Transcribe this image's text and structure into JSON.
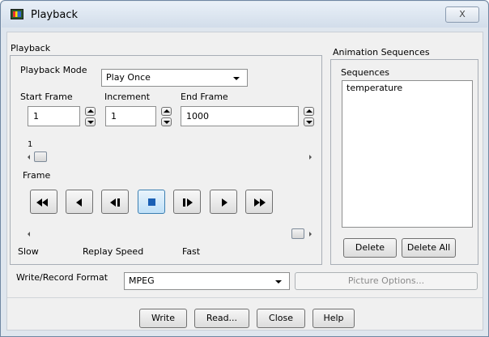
{
  "window": {
    "title": "Playback",
    "close_glyph": "X"
  },
  "playback": {
    "group_label": "Playback",
    "mode_label": "Playback Mode",
    "mode_value": "Play Once",
    "start_frame_label": "Start Frame",
    "increment_label": "Increment",
    "end_frame_label": "End Frame",
    "start_frame_value": "1",
    "increment_value": "1",
    "end_frame_value": "1000",
    "frame_slider_value": "1",
    "frame_label": "Frame",
    "speed_slow_label": "Slow",
    "speed_label": "Replay Speed",
    "speed_fast_label": "Fast",
    "speed_level": 1.0,
    "controls": [
      {
        "name": "rewind",
        "icon": "rewind-icon"
      },
      {
        "name": "step-back",
        "icon": "play-reverse-icon"
      },
      {
        "name": "step-back-frame",
        "icon": "step-back-icon"
      },
      {
        "name": "stop",
        "icon": "stop-icon",
        "active": true
      },
      {
        "name": "step-forward-frame",
        "icon": "step-forward-icon"
      },
      {
        "name": "play",
        "icon": "play-icon"
      },
      {
        "name": "fast-forward",
        "icon": "fast-forward-icon"
      }
    ]
  },
  "animation": {
    "group_label": "Animation Sequences",
    "sequences_label": "Sequences",
    "sequences": [
      "temperature"
    ],
    "delete_label": "Delete",
    "delete_all_label": "Delete All"
  },
  "record": {
    "format_label": "Write/Record Format",
    "format_value": "MPEG",
    "picture_options_label": "Picture Options..."
  },
  "footer": {
    "write_label": "Write",
    "read_label": "Read...",
    "close_label": "Close",
    "help_label": "Help"
  },
  "colors": {
    "window_frame": "#dfe6ee",
    "active_button": "#bfe0f8",
    "stop_icon": "#1a5fb4"
  }
}
